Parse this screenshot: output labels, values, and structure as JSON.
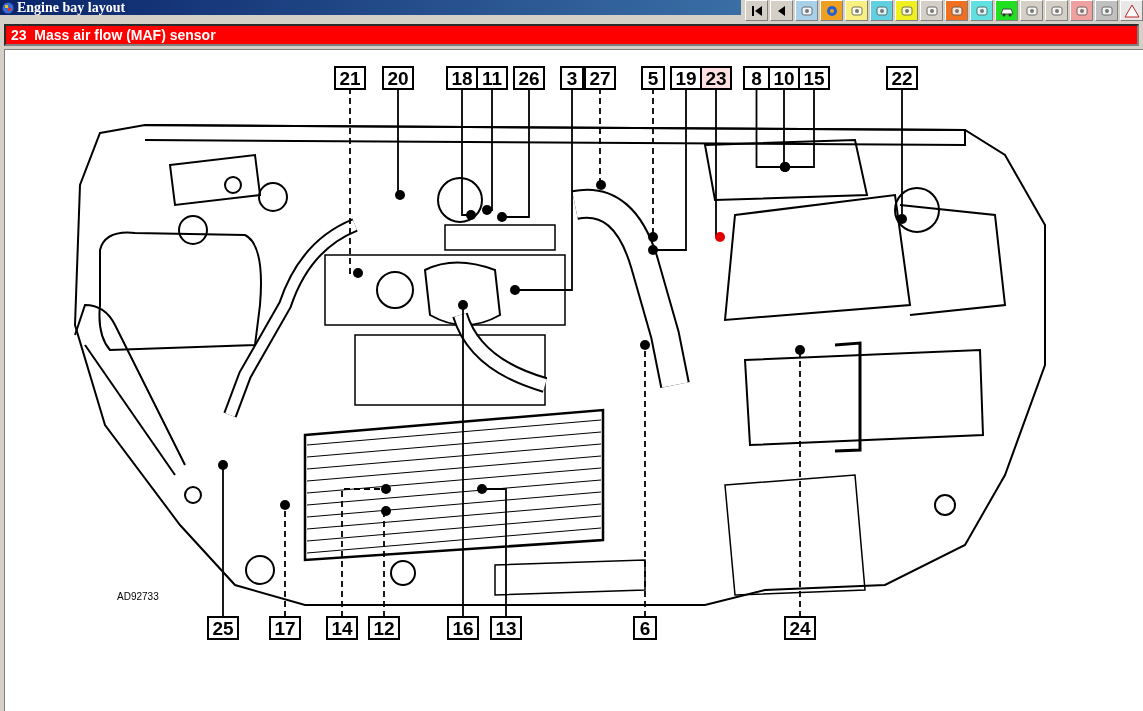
{
  "window": {
    "title": "Engine bay layout"
  },
  "selected_component": {
    "number": "23",
    "name": "Mass air flow (MAF) sensor"
  },
  "diagram": {
    "reference": "AD92733",
    "callouts": [
      {
        "label": "21",
        "selected": false
      },
      {
        "label": "20",
        "selected": false
      },
      {
        "label": "18",
        "selected": false
      },
      {
        "label": "11",
        "selected": false
      },
      {
        "label": "26",
        "selected": false
      },
      {
        "label": "3",
        "selected": false
      },
      {
        "label": "27",
        "selected": false
      },
      {
        "label": "5",
        "selected": false
      },
      {
        "label": "19",
        "selected": false
      },
      {
        "label": "23",
        "selected": true
      },
      {
        "label": "8",
        "selected": false
      },
      {
        "label": "10",
        "selected": false
      },
      {
        "label": "15",
        "selected": false
      },
      {
        "label": "22",
        "selected": false
      },
      {
        "label": "25",
        "selected": false
      },
      {
        "label": "17",
        "selected": false
      },
      {
        "label": "14",
        "selected": false
      },
      {
        "label": "12",
        "selected": false
      },
      {
        "label": "16",
        "selected": false
      },
      {
        "label": "13",
        "selected": false
      },
      {
        "label": "6",
        "selected": false
      },
      {
        "label": "24",
        "selected": false
      }
    ]
  }
}
